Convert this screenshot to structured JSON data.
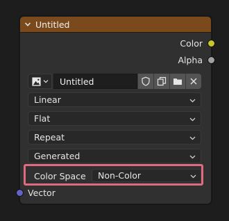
{
  "header": {
    "title": "Untitled"
  },
  "outputs": [
    {
      "label": "Color",
      "color": "#c7c729"
    },
    {
      "label": "Alpha",
      "color": "#a1a1a1"
    }
  ],
  "image": {
    "name": "Untitled"
  },
  "dropdowns": {
    "interpolation": "Linear",
    "projection": "Flat",
    "extension": "Repeat",
    "source": "Generated"
  },
  "color_space": {
    "label": "Color Space",
    "value": "Non-Color"
  },
  "inputs": [
    {
      "label": "Vector",
      "color": "#6363c7"
    }
  ],
  "colors": {
    "header": "#7a4a1d",
    "highlight": "#e06a80"
  }
}
